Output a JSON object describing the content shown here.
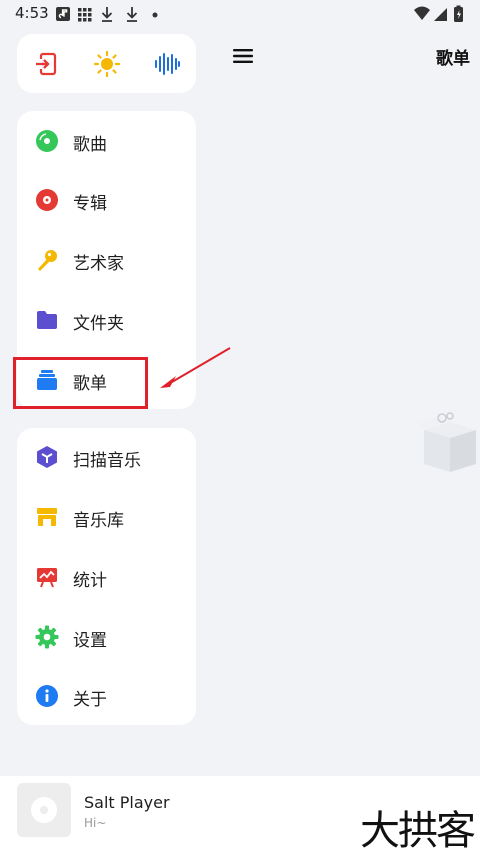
{
  "status_bar": {
    "time": "4:53",
    "left_icons": [
      "music-app-icon",
      "grid-icon",
      "download-icon",
      "download-icon",
      "dot-icon"
    ],
    "right_icons": [
      "wifi-icon",
      "signal-icon",
      "battery-icon"
    ]
  },
  "header": {
    "title": "歌单"
  },
  "drawer": {
    "top_actions": [
      {
        "icon": "exit-icon",
        "color": "#e53935"
      },
      {
        "icon": "sun-icon",
        "color": "#f5b800"
      },
      {
        "icon": "waveform-icon",
        "color": "#1e6fd9"
      }
    ],
    "nav_items": [
      {
        "label": "歌曲",
        "icon": "song-disc-icon",
        "color": "#34c759"
      },
      {
        "label": "专辑",
        "icon": "album-icon",
        "color": "#e53935"
      },
      {
        "label": "艺术家",
        "icon": "microphone-icon",
        "color": "#f5b800"
      },
      {
        "label": "文件夹",
        "icon": "folder-icon",
        "color": "#5b4fcf"
      },
      {
        "label": "歌单",
        "icon": "playlist-icon",
        "color": "#1e7bf2"
      }
    ],
    "tool_items": [
      {
        "label": "扫描音乐",
        "icon": "scan-cube-icon",
        "color": "#5b4fcf"
      },
      {
        "label": "音乐库",
        "icon": "store-icon",
        "color": "#f5b800"
      },
      {
        "label": "统计",
        "icon": "stats-board-icon",
        "color": "#e53935"
      },
      {
        "label": "设置",
        "icon": "gear-icon",
        "color": "#34c759"
      },
      {
        "label": "关于",
        "icon": "info-icon",
        "color": "#1e7bf2"
      }
    ]
  },
  "player": {
    "title": "Salt Player",
    "subtitle": "Hi~"
  },
  "watermark": "大拱客",
  "annotation": {
    "color": "#e0202a",
    "target": "歌单"
  }
}
